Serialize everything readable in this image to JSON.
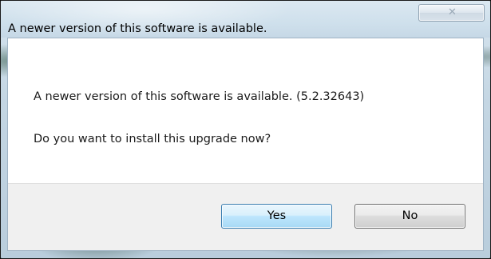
{
  "window": {
    "title": "A newer version of this software is available.",
    "close_icon": "close-icon"
  },
  "message": {
    "line1": "A newer version of this software is available. (5.2.32643)",
    "line2": "Do you want to install this upgrade now?"
  },
  "buttons": {
    "yes_label": "Yes",
    "no_label": "No",
    "default": "Yes"
  },
  "colors": {
    "default_button_border": "#3c7fb1",
    "button_area_bg": "#f0f0f0",
    "client_bg": "#ffffff"
  }
}
